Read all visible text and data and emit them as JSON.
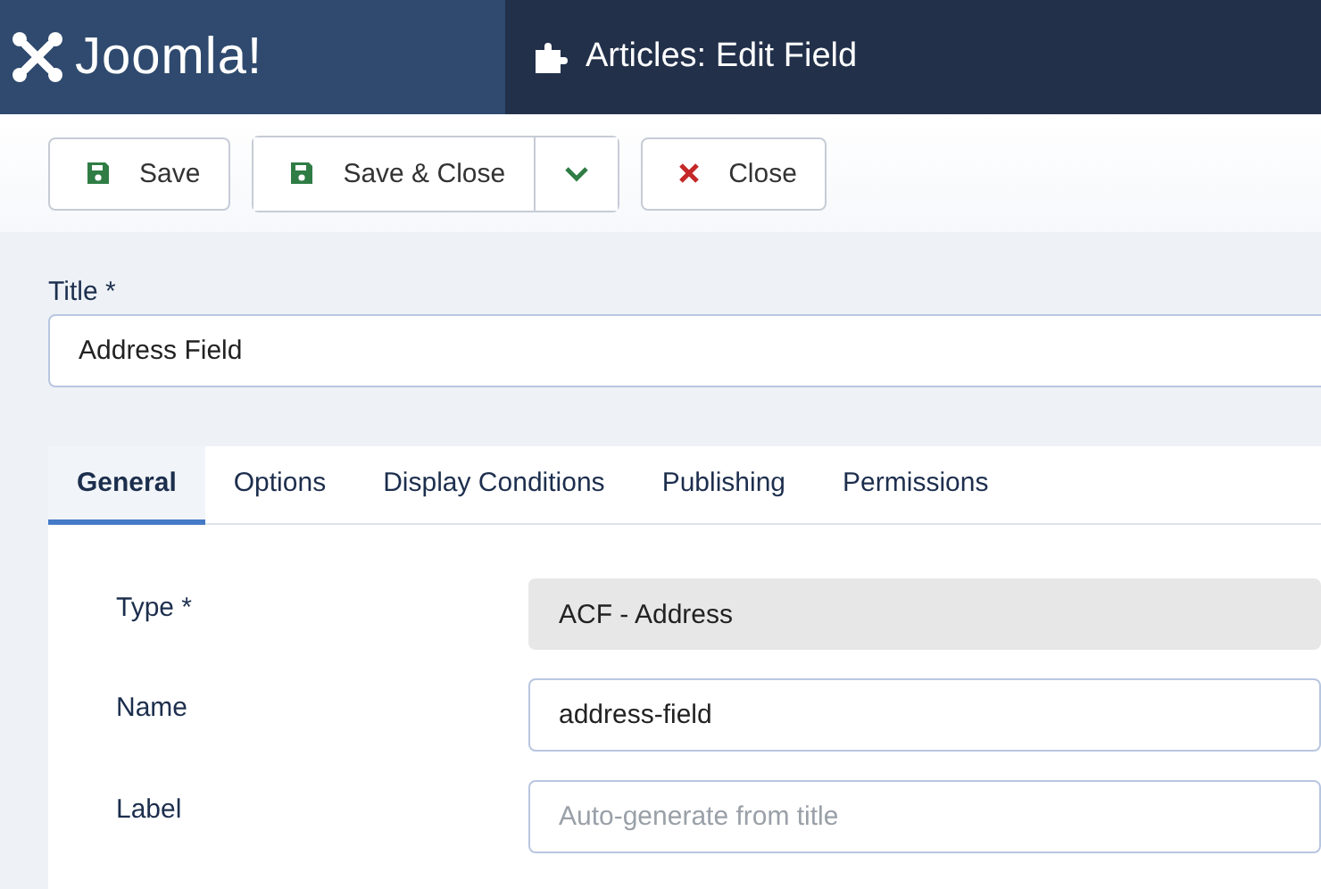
{
  "header": {
    "brand": "Joomla!",
    "title": "Articles: Edit Field"
  },
  "toolbar": {
    "buttons": [
      {
        "label": "Save",
        "kind": "save"
      },
      {
        "label": "Save & Close",
        "kind": "save-split"
      },
      {
        "label": "Close",
        "kind": "close"
      }
    ]
  },
  "title_field": {
    "label": "Title *",
    "value": "Address Field"
  },
  "tabs": [
    {
      "label": "General",
      "selected": true
    },
    {
      "label": "Options",
      "selected": false
    },
    {
      "label": "Display Conditions",
      "selected": false
    },
    {
      "label": "Publishing",
      "selected": false
    },
    {
      "label": "Permissions",
      "selected": false
    }
  ],
  "fields": [
    {
      "label": "Type *",
      "kind": "readonly",
      "value": "ACF - Address"
    },
    {
      "label": "Name",
      "kind": "text",
      "value": "address-field"
    },
    {
      "label": "Label",
      "kind": "text",
      "placeholder": "Auto-generate from title"
    }
  ]
}
